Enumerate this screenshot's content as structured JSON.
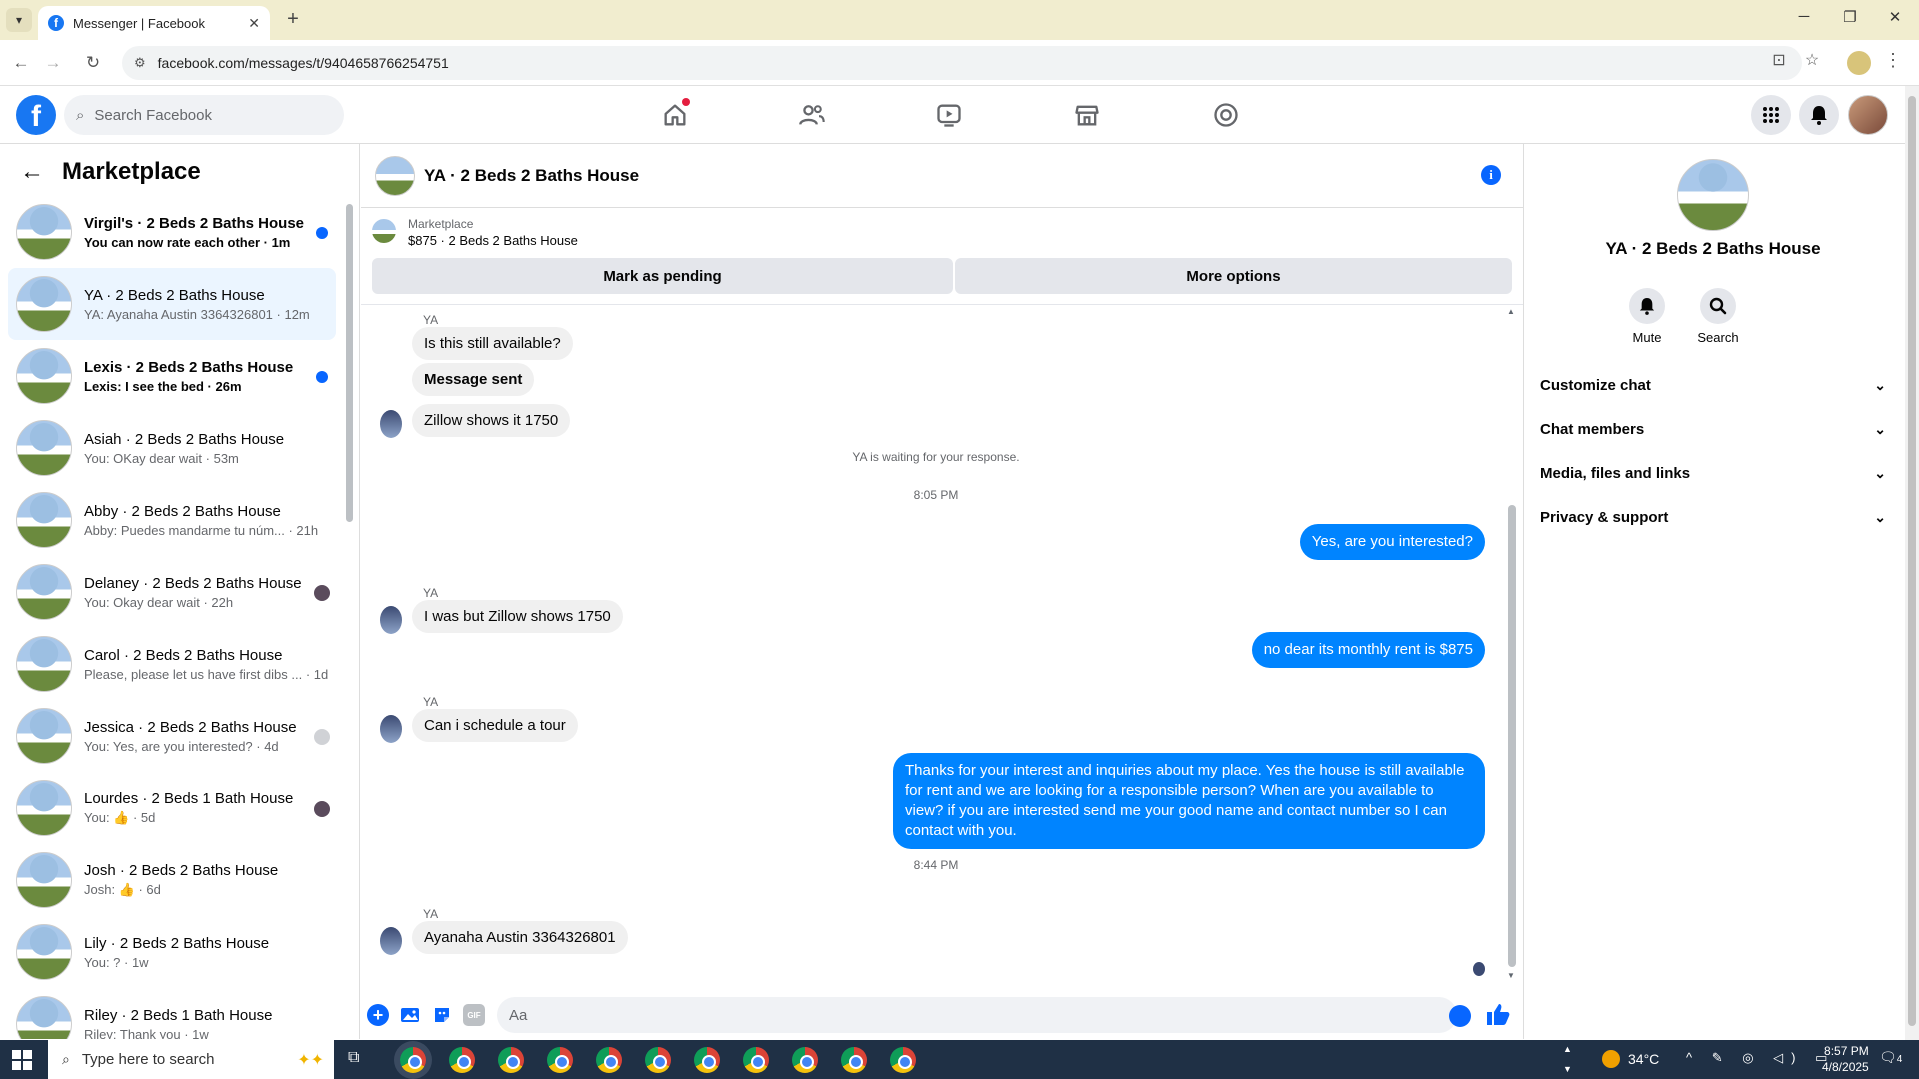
{
  "browser": {
    "tab_title": "Messenger | Facebook",
    "url": "facebook.com/messages/t/9404658766254751"
  },
  "facebook": {
    "search_placeholder": "Search Facebook"
  },
  "sidebar": {
    "title": "Marketplace",
    "conversations": [
      {
        "name": "Virgil's · 2 Beds 2 Baths House",
        "preview": "You can now rate each other · 1m",
        "unread": true
      },
      {
        "name": "YA · 2 Beds 2 Baths House",
        "preview": "YA: Ayanaha Austin 3364326801 · 12m",
        "active": true
      },
      {
        "name": "Lexis · 2 Beds 2 Baths House",
        "preview": "Lexis: I see the bed · 26m",
        "unread": true
      },
      {
        "name": "Asiah · 2 Beds 2 Baths House",
        "preview": "You: OKay dear wait · 53m"
      },
      {
        "name": "Abby · 2 Beds 2 Baths House",
        "preview": "Abby: Puedes mandarme tu núm... · 21h"
      },
      {
        "name": "Delaney · 2 Beds 2 Baths House",
        "preview": "You: Okay dear wait · 22h"
      },
      {
        "name": "Carol · 2 Beds 2 Baths House",
        "preview": "Please, please let us have first dibs ... · 1d"
      },
      {
        "name": "Jessica · 2 Beds 2 Baths House",
        "preview": "You: Yes, are you interested? · 4d"
      },
      {
        "name": "Lourdes · 2 Beds 1 Bath House",
        "preview": "You: 👍 · 5d"
      },
      {
        "name": "Josh · 2 Beds 2 Baths House",
        "preview": "Josh: 👍 · 6d"
      },
      {
        "name": "Lily · 2 Beds 2 Baths House",
        "preview": "You: ? · 1w"
      },
      {
        "name": "Riley · 2 Beds 1 Bath House",
        "preview": "Riley: Thank you · 1w"
      }
    ]
  },
  "chat": {
    "title": "YA · 2 Beds 2 Baths House",
    "marketplace_label": "Marketplace",
    "listing": "$875 · 2 Beds 2 Baths House",
    "mark_pending": "Mark as pending",
    "more_options": "More options",
    "sender_name": "YA",
    "msg1": "Is this still available?",
    "msg2": "Message sent",
    "msg3": "Zillow shows it 1750",
    "waiting": "YA is waiting for your response.",
    "time1": "8:05 PM",
    "out1": "Yes, are you interested?",
    "msg4": "I was but Zillow shows 1750",
    "out2": "no dear its monthly rent is $875",
    "msg5": "Can i schedule a tour",
    "out3": "Thanks for your interest and inquiries about my place. Yes the house is still available for rent and we are looking for a responsible person? When are you available to view? if you are interested send me your good name and contact number so I can contact with you.",
    "time2": "8:44 PM",
    "msg6": "Ayanaha Austin 3364326801",
    "composer_placeholder": "Aa",
    "gif_label": "GIF"
  },
  "right_panel": {
    "title": "YA · 2 Beds 2 Baths House",
    "mute": "Mute",
    "search": "Search",
    "sections": [
      "Customize chat",
      "Chat members",
      "Media, files and links",
      "Privacy & support"
    ]
  },
  "taskbar": {
    "search_placeholder": "Type here to search",
    "temperature": "34°C",
    "time": "8:57 PM",
    "date": "4/8/2025",
    "notif_count": "4"
  },
  "colors": {
    "facebook_blue": "#1877f2",
    "messenger_blue": "#0084ff",
    "unread_dot": "#0866ff"
  }
}
